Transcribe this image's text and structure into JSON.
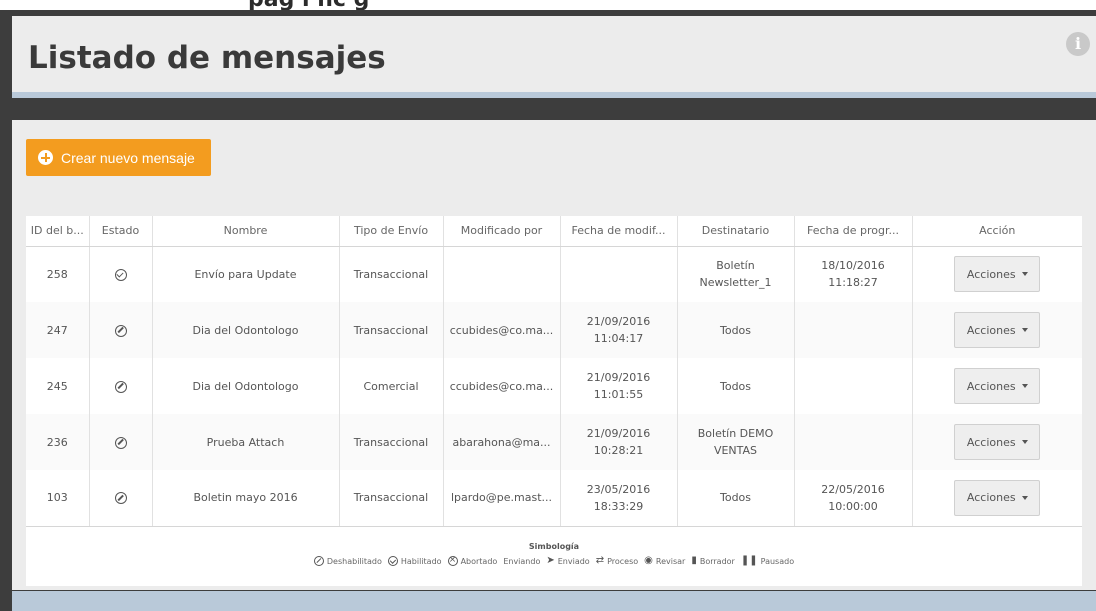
{
  "top_banner": {
    "text": "pag  l  nc  g"
  },
  "header": {
    "title": "Listado de mensajes",
    "info_glyph": "i",
    "info_icon": "info-circle-icon"
  },
  "toolbar": {
    "create_label": "Crear nuevo mensaje",
    "create_icon": "plus-circle-icon"
  },
  "table": {
    "columns": [
      "ID del b...",
      "Estado",
      "Nombre",
      "Tipo de Envío",
      "Modificado por",
      "Fecha de modif...",
      "Destinatario",
      "Fecha de progr...",
      "Acción"
    ],
    "rows": [
      {
        "id": "258",
        "estado": "habilitado",
        "nombre": "Envío para Update",
        "tipo": "Transaccional",
        "modificado_por": "",
        "fecha_modif": [
          "",
          ""
        ],
        "destinatario": [
          "Boletín",
          "Newsletter_1"
        ],
        "fecha_prog": [
          "18/10/2016",
          "11:18:27"
        ],
        "accion": "Acciones"
      },
      {
        "id": "247",
        "estado": "deshabilitado",
        "nombre": "Dia del Odontologo",
        "tipo": "Transaccional",
        "modificado_por": "ccubides@co.ma...",
        "fecha_modif": [
          "21/09/2016",
          "11:04:17"
        ],
        "destinatario": [
          "Todos",
          ""
        ],
        "fecha_prog": [
          "",
          ""
        ],
        "accion": "Acciones"
      },
      {
        "id": "245",
        "estado": "deshabilitado",
        "nombre": "Dia del Odontologo",
        "tipo": "Comercial",
        "modificado_por": "ccubides@co.ma...",
        "fecha_modif": [
          "21/09/2016",
          "11:01:55"
        ],
        "destinatario": [
          "Todos",
          ""
        ],
        "fecha_prog": [
          "",
          ""
        ],
        "accion": "Acciones"
      },
      {
        "id": "236",
        "estado": "deshabilitado",
        "nombre": "Prueba Attach",
        "tipo": "Transaccional",
        "modificado_por": "abarahona@ma...",
        "fecha_modif": [
          "21/09/2016",
          "10:28:21"
        ],
        "destinatario": [
          "Boletín DEMO",
          "VENTAS"
        ],
        "fecha_prog": [
          "",
          ""
        ],
        "accion": "Acciones"
      },
      {
        "id": "103",
        "estado": "deshabilitado",
        "nombre": "Boletin mayo 2016",
        "tipo": "Transaccional",
        "modificado_por": "lpardo@pe.mast...",
        "fecha_modif": [
          "23/05/2016",
          "18:33:29"
        ],
        "destinatario": [
          "Todos",
          ""
        ],
        "fecha_prog": [
          "22/05/2016",
          "10:00:00"
        ],
        "accion": "Acciones"
      }
    ]
  },
  "legend": {
    "title": "Simbología",
    "items": [
      {
        "label": "Deshabilitado",
        "icon": "disabled-circle-icon"
      },
      {
        "label": "Habilitado",
        "icon": "check-circle-icon",
        "glyph": ""
      },
      {
        "label": "Abortado",
        "icon": "x-circle-icon"
      },
      {
        "label": "Enviando",
        "icon": "sending-icon"
      },
      {
        "label": "Enviado",
        "icon": "paper-plane-icon",
        "glyph": "➤"
      },
      {
        "label": "Proceso",
        "icon": "exchange-icon",
        "glyph": "⇄"
      },
      {
        "label": "Revisar",
        "icon": "eye-icon",
        "glyph": "◉"
      },
      {
        "label": "Borrador",
        "icon": "document-icon",
        "glyph": "▮"
      },
      {
        "label": "Pausado",
        "icon": "pause-icon",
        "glyph": "❚❚"
      }
    ]
  },
  "colors": {
    "accent": "#f39c1f",
    "frame": "#3d3d3d",
    "panel": "#ececec",
    "band": "#b9c9d9"
  }
}
